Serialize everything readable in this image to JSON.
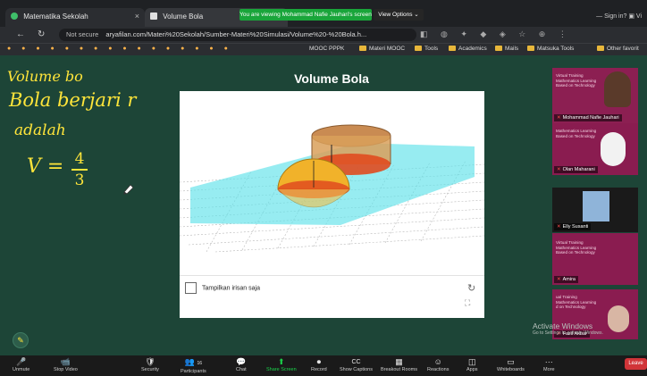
{
  "browser": {
    "tabs": [
      {
        "label": "Matematika Sekolah",
        "close": "×"
      },
      {
        "label": "Volume Bola"
      }
    ],
    "share_banner": "You are viewing Mohammad Nafie Jauhari's screen",
    "view_options": "View Options  ⌄",
    "window_controls": "— Sign in?  ▣ Vi",
    "url_prefix": "Not secure",
    "url": "aryafilan.com/Materi%20Sekolah/Sumber-Materi%20Simulasi/Volume%20-%20Bola.h...",
    "bookmarks": [
      "MOOC PPPK",
      "Materi MOOC",
      "Tools",
      "Academics",
      "Mails",
      "Matsuka Tools",
      "Other favorit"
    ]
  },
  "whiteboard": {
    "line1": "Volume bo",
    "line2": "Bola berjari r",
    "line3": "adalah",
    "formula_lhs": "V =",
    "frac_num": "4",
    "frac_den": "3"
  },
  "applet": {
    "title": "Volume Bola",
    "checkbox_label": "Tampilkan irisan saja",
    "refresh_icon": "↻",
    "fullscreen_icon": "⛶"
  },
  "participants": [
    {
      "name": "Mohammad Nafie Jauhari",
      "slide": "Virtual Training\nMathematics Learning\nBased on Technology"
    },
    {
      "name": "Olan Maharani",
      "slide": "Mathematics Learning\nBased on Technology"
    },
    {
      "name": "Elly Susanti",
      "slide": ""
    },
    {
      "name": "Amira",
      "slide": "Virtual Training\nMathematics Learning\nBased on Technology"
    },
    {
      "name": "Fazil Akbar",
      "slide": "ual Training\nMathematics Learning\nd on Technology"
    }
  ],
  "watermark": {
    "title": "Activate Windows",
    "sub": "Go to Settings to activate Windows."
  },
  "toolbar": [
    {
      "label": "Unmute",
      "icon": "🎤"
    },
    {
      "label": "Stop Video",
      "icon": "📹"
    },
    {
      "label": "Security",
      "icon": "🛡"
    },
    {
      "label": "Participants",
      "icon": "👥",
      "count": "16"
    },
    {
      "label": "Chat",
      "icon": "💬"
    },
    {
      "label": "Share Screen",
      "icon": "⬆"
    },
    {
      "label": "Record",
      "icon": "⏺"
    },
    {
      "label": "Show Captions",
      "icon": "CC"
    },
    {
      "label": "Breakout Rooms",
      "icon": "▦"
    },
    {
      "label": "Reactions",
      "icon": "☺"
    },
    {
      "label": "Apps",
      "icon": "◫"
    },
    {
      "label": "Whiteboards",
      "icon": "▭"
    },
    {
      "label": "More",
      "icon": "···"
    }
  ],
  "leave_label": "Leave",
  "colors": {
    "board_bg": "#1d4537",
    "ink": "#ffe53a",
    "share_green": "#19a53a",
    "leave_red": "#d13438"
  }
}
